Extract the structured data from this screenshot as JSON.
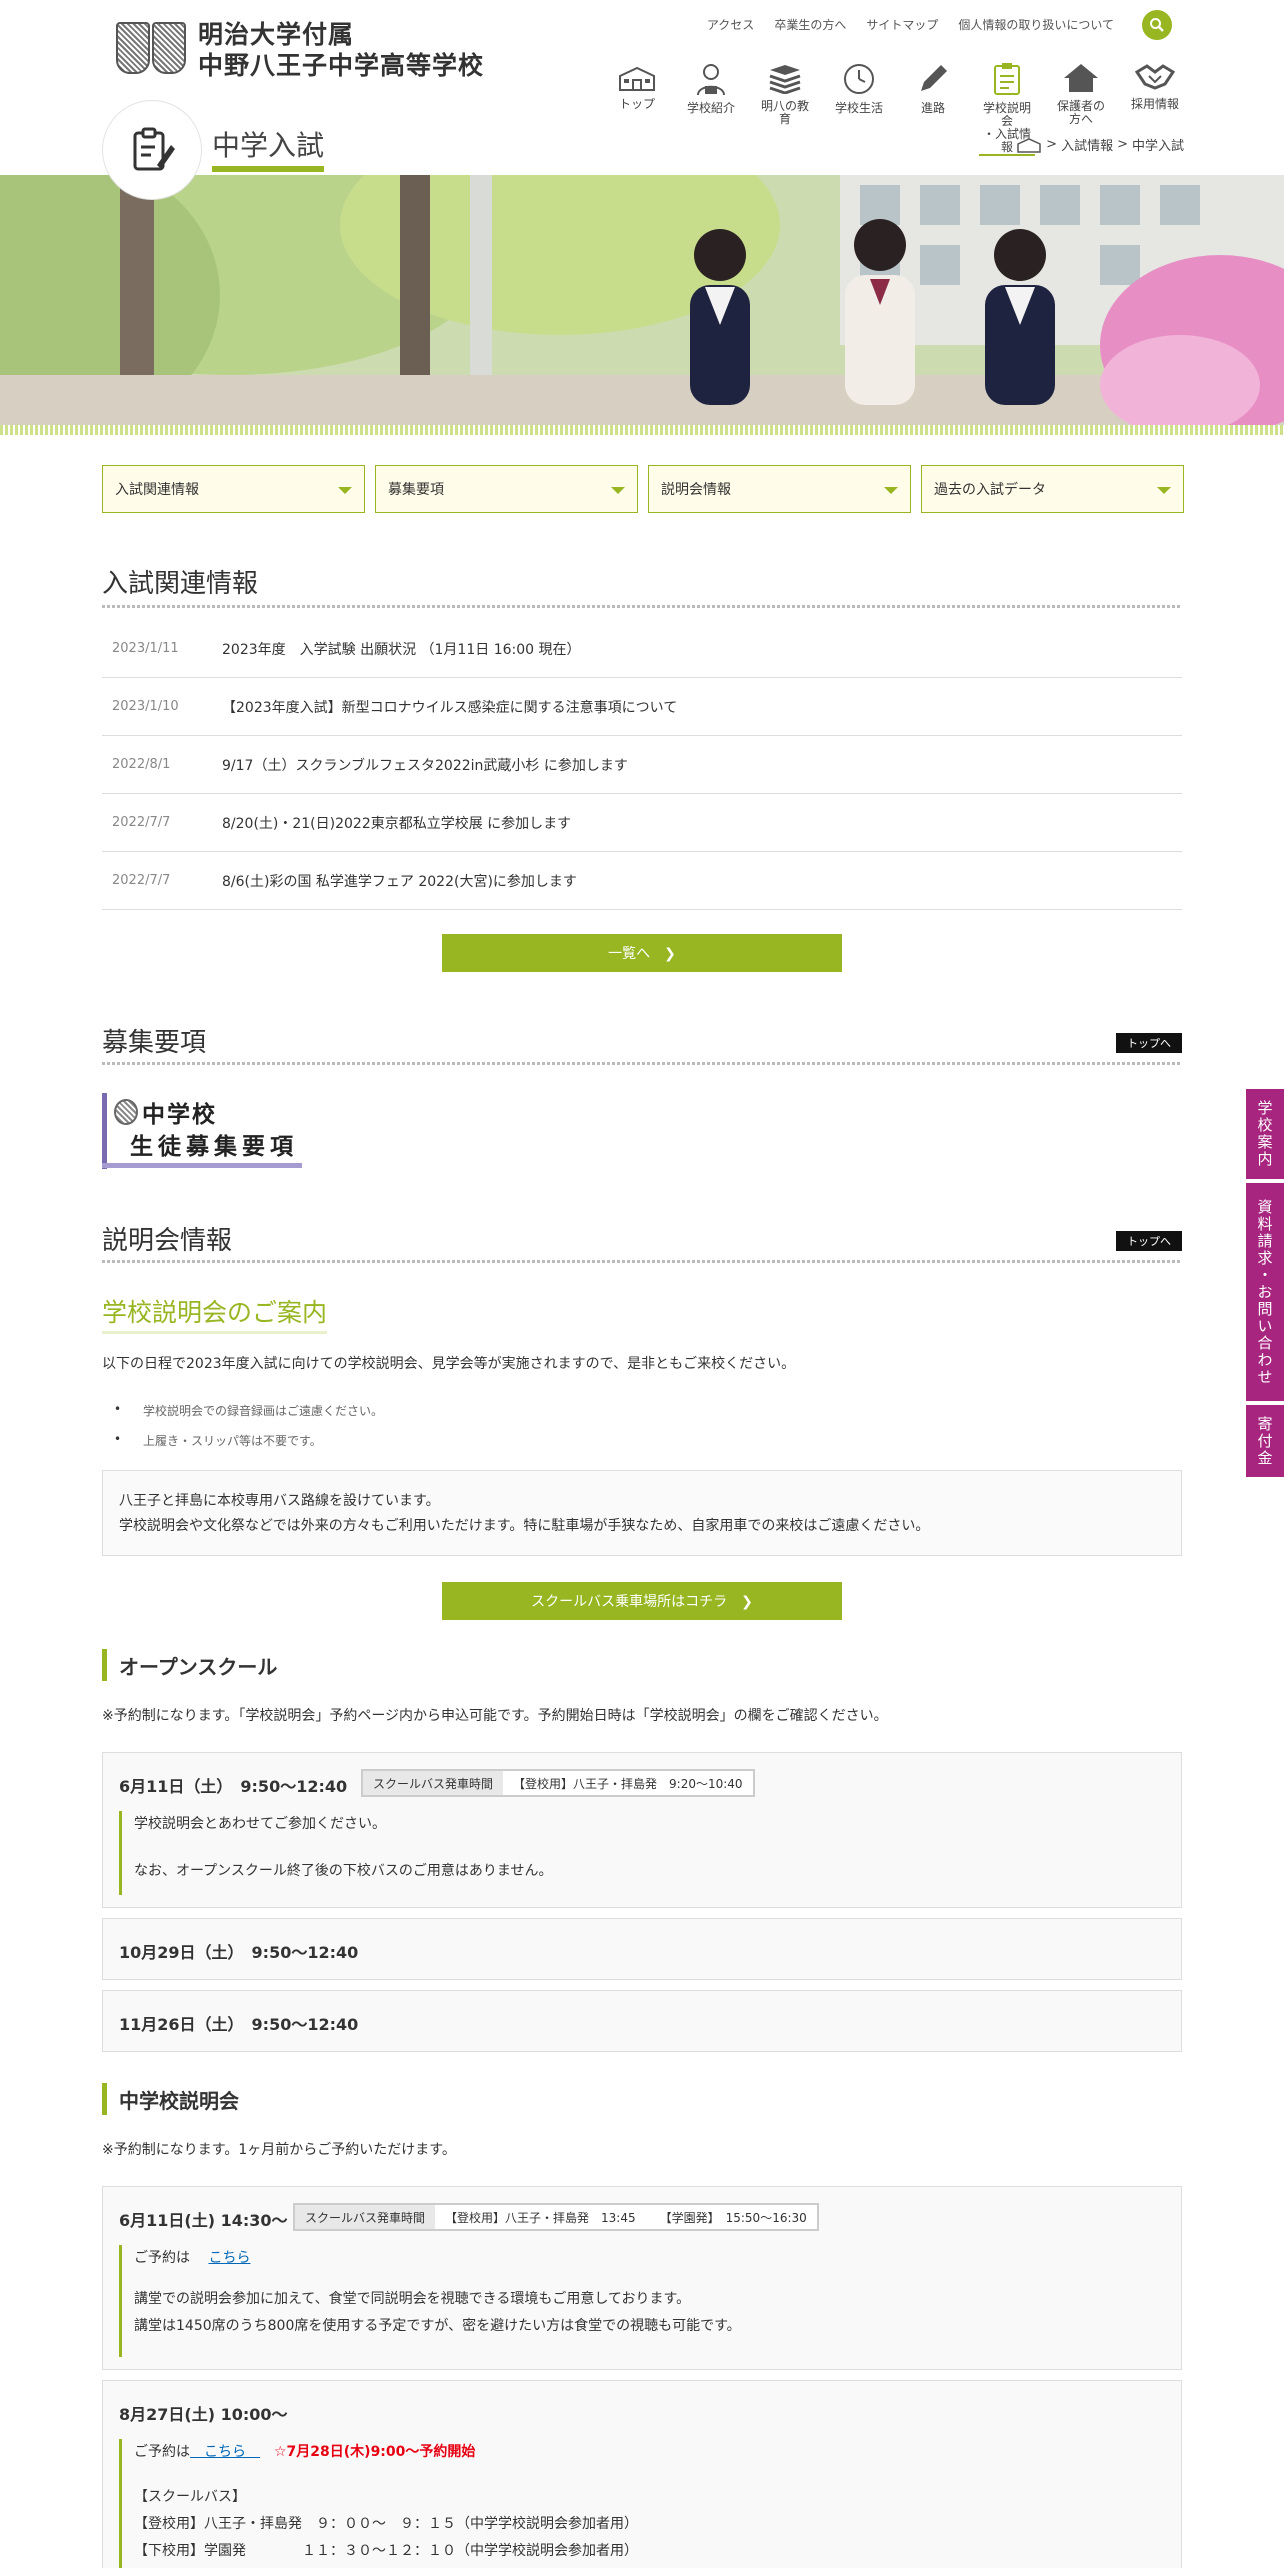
{
  "header": {
    "logo_line1": "明治大学付属",
    "logo_line2": "中野八王子中学高等学校",
    "topnav": [
      "アクセス",
      "卒業生の方へ",
      "サイトマップ",
      "個人情報の取り扱いについて"
    ],
    "mainnav": [
      {
        "label": "トップ",
        "icon": "school-icon"
      },
      {
        "label": "学校紹介",
        "icon": "student-icon"
      },
      {
        "label": "明八の教育",
        "icon": "books-icon"
      },
      {
        "label": "学校生活",
        "icon": "clock-icon"
      },
      {
        "label": "進路",
        "icon": "pencil-icon"
      },
      {
        "label": "学校説明会",
        "label2": "・入試情報",
        "icon": "clipboard-icon"
      },
      {
        "label": "保護者の方へ",
        "icon": "house-icon"
      },
      {
        "label": "採用情報",
        "icon": "handshake-icon"
      }
    ],
    "page_title": "中学入試",
    "breadcrumb": [
      ">",
      "入試情報",
      ">",
      "中学入試"
    ]
  },
  "tabs": [
    "入試関連情報",
    "募集要項",
    "説明会情報",
    "過去の入試データ"
  ],
  "news_section": {
    "title": "入試関連情報",
    "items": [
      {
        "date": "2023/1/11",
        "title": "2023年度　入学試験 出願状況 （1月11日 16:00 現在）"
      },
      {
        "date": "2023/1/10",
        "title": "【2023年度入試】新型コロナウイルス感染症に関する注意事項について"
      },
      {
        "date": "2022/8/1",
        "title": "9/17（土）スクランブルフェスタ2022in武蔵小杉 に参加します"
      },
      {
        "date": "2022/7/7",
        "title": "8/20(土)・21(日)2022東京都私立学校展 に参加します"
      },
      {
        "date": "2022/7/7",
        "title": "8/6(土)彩の国 私学進学フェア 2022(大宮)に参加します"
      }
    ],
    "more_button": "一覧へ　❯"
  },
  "boshu": {
    "title": "募集要項",
    "top_button": "トップへ",
    "image_line1": "中学校",
    "image_line2": "生徒募集要項"
  },
  "setsumei": {
    "title": "説明会情報",
    "top_button": "トップへ",
    "subtitle": "学校説明会のご案内",
    "intro": "以下の日程で2023年度入試に向けての学校説明会、見学会等が実施されますので、是非ともご来校ください。",
    "bullets": [
      "学校説明会での録音録画はご遠慮ください。",
      "上履き・スリッパ等は不要です。"
    ],
    "notice_line1": "八王子と拝島に本校専用バス路線を設けています。",
    "notice_line2": "学校説明会や文化祭などでは外来の方々もご利用いただけます。特に駐車場が手狭なため、自家用車での来校はご遠慮ください。",
    "bus_button": "スクールバス乗車場所はコチラ　❯"
  },
  "open_school": {
    "title": "オープンスクール",
    "note": "※予約制になります。「学校説明会」予約ページ内から申込可能です。予約開始日時は「学校説明会」の欄をご確認ください。",
    "bus_label": "スクールバス発車時間",
    "events": [
      {
        "date": "6月11日（土）　9:50～12:40",
        "bus": "【登校用】八王子・拝島発　9:20～10:40",
        "body1": "学校説明会とあわせてご参加ください。",
        "body2": "なお、オープンスクール終了後の下校バスのご用意はありません。"
      },
      {
        "date": "10月29日（土）　9:50～12:40"
      },
      {
        "date": "11月26日（土）　9:50～12:40"
      }
    ]
  },
  "chu_setsumei": {
    "title": "中学校説明会",
    "note": "※予約制になります。1ヶ月前からご予約いただけます。",
    "bus_label": "スクールバス発車時間",
    "events": [
      {
        "date": "6月11日(土) 14:30～",
        "bus_a": "【登校用】八王子・拝島発　13:45",
        "bus_b": "【学園発】　15:50～16:30",
        "yoyaku": "ご予約は　",
        "link": "こちら",
        "body1": "講堂での説明会参加に加えて、食堂で同説明会を視聴できる環境もご用意しております。",
        "body2": "講堂は1450席のうち800席を使用する予定ですが、密を避けたい方は食堂での視聴も可能です。"
      },
      {
        "date": "8月27日(土) 10:00～",
        "yoyaku": "ご予約は",
        "link": "　こちら　",
        "start": "☆7月28日(木)9:00～予約開始",
        "bus_head": "【スクールバス】",
        "bus_1": "【登校用】八王子・拝島発　９：００～　９：１５（中学学校説明会参加者用）",
        "bus_2": "【下校用】学園発　　　　１１：３０～１２：１０（中学学校説明会参加者用）"
      }
    ]
  },
  "side_tabs": [
    "学校案内",
    "資料請求・お問い合わせ",
    "寄付金"
  ],
  "colors": {
    "accent": "#97b621",
    "side": "#a7247f"
  }
}
